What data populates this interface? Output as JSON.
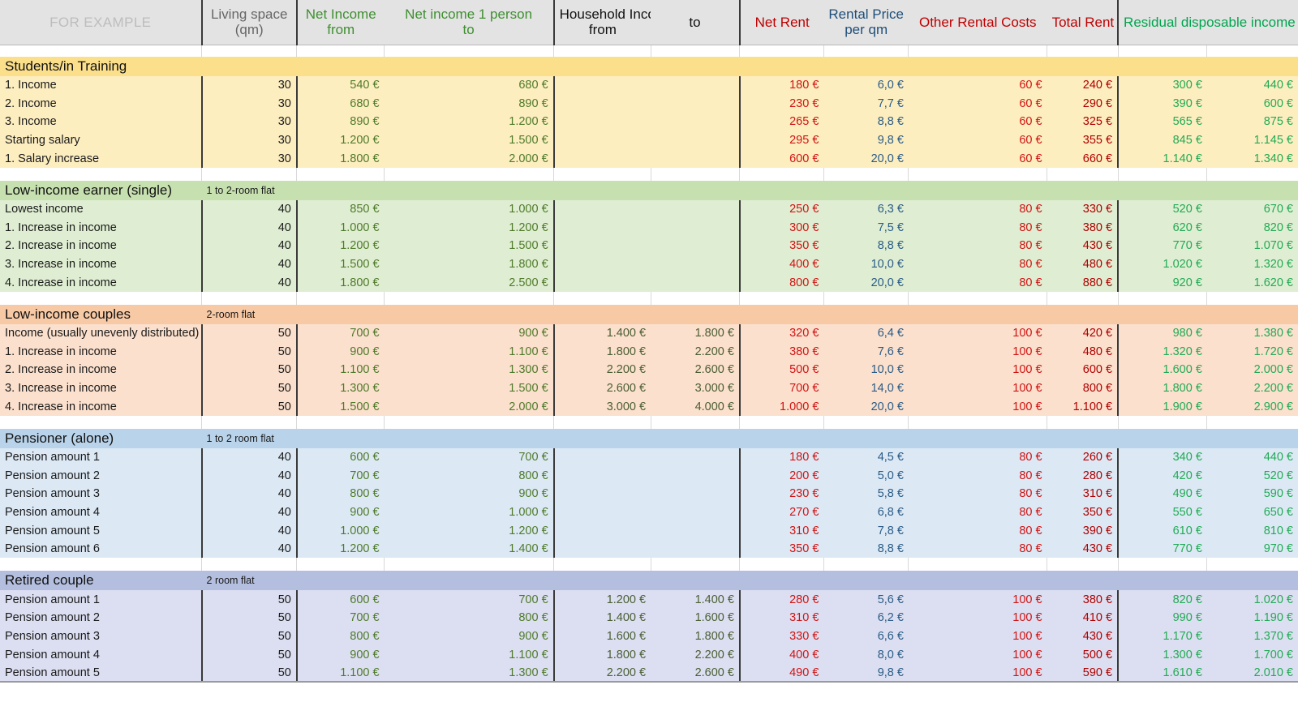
{
  "header": {
    "example_label": "FOR EXAMPLE",
    "columns": [
      {
        "name": "living-space",
        "line1": "Living space",
        "line2": "(qm)",
        "color": "#666666"
      },
      {
        "name": "net-income-from",
        "line1": "Net Income",
        "line2": "from",
        "color": "#3f8f31"
      },
      {
        "name": "net-income-1-person-to",
        "line1": "Net income 1 person",
        "line2": "to",
        "color": "#3f8f31"
      },
      {
        "name": "household-income-from",
        "line1": "Household Income",
        "line2": "from",
        "color": "#111111"
      },
      {
        "name": "household-income-to",
        "line1": "",
        "line2": "to",
        "color": "#111111"
      },
      {
        "name": "net-rent",
        "line1": "Net Rent",
        "line2": "",
        "color": "#c00000"
      },
      {
        "name": "rental-price-per-qm",
        "line1": "Rental Price",
        "line2": "per qm",
        "color": "#1f4e79"
      },
      {
        "name": "other-rental-costs",
        "line1": "Other Rental Costs",
        "line2": "",
        "color": "#c00000"
      },
      {
        "name": "total-rent",
        "line1": "Total Rent",
        "line2": "",
        "color": "#c00000"
      },
      {
        "name": "residual-disposable-income",
        "line1": "Residual disposable income",
        "line2": "",
        "color": "#00a64f"
      }
    ]
  },
  "colors": {
    "green_income": "#4f7a2a",
    "household": "#4b5e34",
    "rent_red": "#d01313",
    "price_blue": "#2a5b86",
    "total_red": "#b00000",
    "residual_green": "#22aa55",
    "header_bg": "#e3e3e3"
  },
  "sections": [
    {
      "title": "Students/in Training",
      "note": "",
      "palette": "s-yellow",
      "rows": [
        {
          "label": "1. Income",
          "space": "30",
          "net_from": "540 €",
          "net_to": "680 €",
          "hh_from": "",
          "hh_to": "",
          "net_rent": "180 €",
          "price": "6,0 €",
          "other": "60 €",
          "total": "240 €",
          "res_from": "300 €",
          "res_to": "440 €"
        },
        {
          "label": "2. Income",
          "space": "30",
          "net_from": "680 €",
          "net_to": "890 €",
          "hh_from": "",
          "hh_to": "",
          "net_rent": "230 €",
          "price": "7,7 €",
          "other": "60 €",
          "total": "290 €",
          "res_from": "390 €",
          "res_to": "600 €"
        },
        {
          "label": "3. Income",
          "space": "30",
          "net_from": "890 €",
          "net_to": "1.200 €",
          "hh_from": "",
          "hh_to": "",
          "net_rent": "265 €",
          "price": "8,8 €",
          "other": "60 €",
          "total": "325 €",
          "res_from": "565 €",
          "res_to": "875 €"
        },
        {
          "label": "Starting salary",
          "space": "30",
          "net_from": "1.200 €",
          "net_to": "1.500 €",
          "hh_from": "",
          "hh_to": "",
          "net_rent": "295 €",
          "price": "9,8 €",
          "other": "60 €",
          "total": "355 €",
          "res_from": "845 €",
          "res_to": "1.145 €"
        },
        {
          "label": "1. Salary increase",
          "space": "30",
          "net_from": "1.800 €",
          "net_to": "2.000 €",
          "hh_from": "",
          "hh_to": "",
          "net_rent": "600 €",
          "price": "20,0 €",
          "other": "60 €",
          "total": "660 €",
          "res_from": "1.140 €",
          "res_to": "1.340 €"
        }
      ]
    },
    {
      "title": "Low-income earner (single)",
      "note": "1 to 2-room flat",
      "palette": "s-green",
      "rows": [
        {
          "label": "Lowest income",
          "space": "40",
          "net_from": "850 €",
          "net_to": "1.000 €",
          "hh_from": "",
          "hh_to": "",
          "net_rent": "250 €",
          "price": "6,3 €",
          "other": "80 €",
          "total": "330 €",
          "res_from": "520 €",
          "res_to": "670 €"
        },
        {
          "label": "1. Increase in income",
          "space": "40",
          "net_from": "1.000 €",
          "net_to": "1.200 €",
          "hh_from": "",
          "hh_to": "",
          "net_rent": "300 €",
          "price": "7,5 €",
          "other": "80 €",
          "total": "380 €",
          "res_from": "620 €",
          "res_to": "820 €"
        },
        {
          "label": "2. Increase in income",
          "space": "40",
          "net_from": "1.200 €",
          "net_to": "1.500 €",
          "hh_from": "",
          "hh_to": "",
          "net_rent": "350 €",
          "price": "8,8 €",
          "other": "80 €",
          "total": "430 €",
          "res_from": "770 €",
          "res_to": "1.070 €"
        },
        {
          "label": "3. Increase in income",
          "space": "40",
          "net_from": "1.500 €",
          "net_to": "1.800 €",
          "hh_from": "",
          "hh_to": "",
          "net_rent": "400 €",
          "price": "10,0 €",
          "other": "80 €",
          "total": "480 €",
          "res_from": "1.020 €",
          "res_to": "1.320 €"
        },
        {
          "label": "4. Increase in income",
          "space": "40",
          "net_from": "1.800 €",
          "net_to": "2.500 €",
          "hh_from": "",
          "hh_to": "",
          "net_rent": "800 €",
          "price": "20,0 €",
          "other": "80 €",
          "total": "880 €",
          "res_from": "920 €",
          "res_to": "1.620 €"
        }
      ]
    },
    {
      "title": "Low-income couples",
      "note": "2-room flat",
      "palette": "s-orange",
      "rows": [
        {
          "label": "Income (usually unevenly distributed)",
          "space": "50",
          "net_from": "700 €",
          "net_to": "900 €",
          "hh_from": "1.400 €",
          "hh_to": "1.800 €",
          "net_rent": "320 €",
          "price": "6,4 €",
          "other": "100 €",
          "total": "420 €",
          "res_from": "980 €",
          "res_to": "1.380 €"
        },
        {
          "label": "1. Increase in income",
          "space": "50",
          "net_from": "900 €",
          "net_to": "1.100 €",
          "hh_from": "1.800 €",
          "hh_to": "2.200 €",
          "net_rent": "380 €",
          "price": "7,6 €",
          "other": "100 €",
          "total": "480 €",
          "res_from": "1.320 €",
          "res_to": "1.720 €"
        },
        {
          "label": "2. Increase in income",
          "space": "50",
          "net_from": "1.100 €",
          "net_to": "1.300 €",
          "hh_from": "2.200 €",
          "hh_to": "2.600 €",
          "net_rent": "500 €",
          "price": "10,0 €",
          "other": "100 €",
          "total": "600 €",
          "res_from": "1.600 €",
          "res_to": "2.000 €"
        },
        {
          "label": "3. Increase in income",
          "space": "50",
          "net_from": "1.300 €",
          "net_to": "1.500 €",
          "hh_from": "2.600 €",
          "hh_to": "3.000 €",
          "net_rent": "700 €",
          "price": "14,0 €",
          "other": "100 €",
          "total": "800 €",
          "res_from": "1.800 €",
          "res_to": "2.200 €"
        },
        {
          "label": "4. Increase in income",
          "space": "50",
          "net_from": "1.500 €",
          "net_to": "2.000 €",
          "hh_from": "3.000 €",
          "hh_to": "4.000 €",
          "net_rent": "1.000 €",
          "price": "20,0 €",
          "other": "100 €",
          "total": "1.100 €",
          "res_from": "1.900 €",
          "res_to": "2.900 €"
        }
      ]
    },
    {
      "title": "Pensioner (alone)",
      "note": "1 to 2 room flat",
      "palette": "s-blue",
      "rows": [
        {
          "label": "Pension amount 1",
          "space": "40",
          "net_from": "600 €",
          "net_to": "700 €",
          "hh_from": "",
          "hh_to": "",
          "net_rent": "180 €",
          "price": "4,5 €",
          "other": "80 €",
          "total": "260 €",
          "res_from": "340 €",
          "res_to": "440 €"
        },
        {
          "label": "Pension amount 2",
          "space": "40",
          "net_from": "700 €",
          "net_to": "800 €",
          "hh_from": "",
          "hh_to": "",
          "net_rent": "200 €",
          "price": "5,0 €",
          "other": "80 €",
          "total": "280 €",
          "res_from": "420 €",
          "res_to": "520 €"
        },
        {
          "label": "Pension amount 3",
          "space": "40",
          "net_from": "800 €",
          "net_to": "900 €",
          "hh_from": "",
          "hh_to": "",
          "net_rent": "230 €",
          "price": "5,8 €",
          "other": "80 €",
          "total": "310 €",
          "res_from": "490 €",
          "res_to": "590 €"
        },
        {
          "label": "Pension amount 4",
          "space": "40",
          "net_from": "900 €",
          "net_to": "1.000 €",
          "hh_from": "",
          "hh_to": "",
          "net_rent": "270 €",
          "price": "6,8 €",
          "other": "80 €",
          "total": "350 €",
          "res_from": "550 €",
          "res_to": "650 €"
        },
        {
          "label": "Pension amount 5",
          "space": "40",
          "net_from": "1.000 €",
          "net_to": "1.200 €",
          "hh_from": "",
          "hh_to": "",
          "net_rent": "310 €",
          "price": "7,8 €",
          "other": "80 €",
          "total": "390 €",
          "res_from": "610 €",
          "res_to": "810 €"
        },
        {
          "label": "Pension amount 6",
          "space": "40",
          "net_from": "1.200 €",
          "net_to": "1.400 €",
          "hh_from": "",
          "hh_to": "",
          "net_rent": "350 €",
          "price": "8,8 €",
          "other": "80 €",
          "total": "430 €",
          "res_from": "770 €",
          "res_to": "970 €"
        }
      ]
    },
    {
      "title": "Retired couple",
      "note": "2 room flat",
      "palette": "s-indigo",
      "rows": [
        {
          "label": "Pension amount 1",
          "space": "50",
          "net_from": "600 €",
          "net_to": "700 €",
          "hh_from": "1.200 €",
          "hh_to": "1.400 €",
          "net_rent": "280 €",
          "price": "5,6 €",
          "other": "100 €",
          "total": "380 €",
          "res_from": "820 €",
          "res_to": "1.020 €"
        },
        {
          "label": "Pension amount 2",
          "space": "50",
          "net_from": "700 €",
          "net_to": "800 €",
          "hh_from": "1.400 €",
          "hh_to": "1.600 €",
          "net_rent": "310 €",
          "price": "6,2 €",
          "other": "100 €",
          "total": "410 €",
          "res_from": "990 €",
          "res_to": "1.190 €"
        },
        {
          "label": "Pension amount 3",
          "space": "50",
          "net_from": "800 €",
          "net_to": "900 €",
          "hh_from": "1.600 €",
          "hh_to": "1.800 €",
          "net_rent": "330 €",
          "price": "6,6 €",
          "other": "100 €",
          "total": "430 €",
          "res_from": "1.170 €",
          "res_to": "1.370 €"
        },
        {
          "label": "Pension amount 4",
          "space": "50",
          "net_from": "900 €",
          "net_to": "1.100 €",
          "hh_from": "1.800 €",
          "hh_to": "2.200 €",
          "net_rent": "400 €",
          "price": "8,0 €",
          "other": "100 €",
          "total": "500 €",
          "res_from": "1.300 €",
          "res_to": "1.700 €"
        },
        {
          "label": "Pension amount 5",
          "space": "50",
          "net_from": "1.100 €",
          "net_to": "1.300 €",
          "hh_from": "2.200 €",
          "hh_to": "2.600 €",
          "net_rent": "490 €",
          "price": "9,8 €",
          "other": "100 €",
          "total": "590 €",
          "res_from": "1.610 €",
          "res_to": "2.010 €"
        }
      ]
    }
  ]
}
